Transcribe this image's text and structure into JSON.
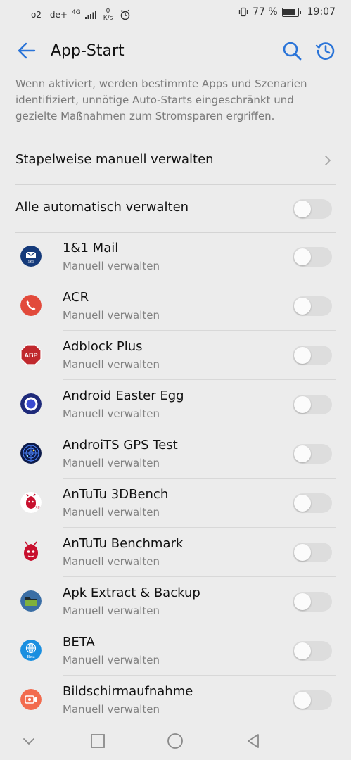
{
  "status": {
    "carrier": "o2 - de+",
    "network": "4G",
    "speed_value": "0",
    "speed_unit": "K/s",
    "battery": "77 %",
    "time": "19:07"
  },
  "header": {
    "title": "App-Start",
    "back_icon": "arrow-left-icon",
    "search_icon": "search-icon",
    "history_icon": "history-icon",
    "accent": "#2a74d8"
  },
  "description": "Wenn aktiviert, werden bestimmte Apps und Szenarien identifiziert, unnötige Auto-Starts eingeschränkt und gezielte Maßnahmen zum Stromsparen ergriffen.",
  "batch": {
    "label": "Stapelweise manuell verwalten"
  },
  "all_auto": {
    "label": "Alle automatisch verwalten",
    "enabled": false
  },
  "apps": [
    {
      "name": "1&1 Mail",
      "status": "Manuell verwalten",
      "icon": "mail-icon",
      "color": "#153a7a",
      "enabled": false
    },
    {
      "name": "ACR",
      "status": "Manuell verwalten",
      "icon": "phone-icon",
      "color": "#e24a3b",
      "enabled": false
    },
    {
      "name": "Adblock Plus",
      "status": "Manuell verwalten",
      "icon": "abp-icon",
      "color": "#c0282d",
      "enabled": false
    },
    {
      "name": "Android Easter Egg",
      "status": "Manuell verwalten",
      "icon": "easter-egg-icon",
      "color": "#1e2a7a",
      "enabled": false
    },
    {
      "name": "AndroiTS GPS Test",
      "status": "Manuell verwalten",
      "icon": "radar-icon",
      "color": "#0d1b4a",
      "enabled": false
    },
    {
      "name": "AnTuTu 3DBench",
      "status": "Manuell verwalten",
      "icon": "antutu-3d-icon",
      "color": "#c8102e",
      "enabled": false
    },
    {
      "name": "AnTuTu Benchmark",
      "status": "Manuell verwalten",
      "icon": "antutu-icon",
      "color": "#c8102e",
      "enabled": false
    },
    {
      "name": "Apk Extract & Backup",
      "status": "Manuell verwalten",
      "icon": "folder-icon",
      "color": "#3a6ea5",
      "enabled": false
    },
    {
      "name": "BETA",
      "status": "Manuell verwalten",
      "icon": "globe-icon",
      "color": "#1a8fe0",
      "enabled": false
    },
    {
      "name": "Bildschirmaufnahme",
      "status": "Manuell verwalten",
      "icon": "screen-record-icon",
      "color": "#f26b4e",
      "enabled": false
    }
  ],
  "navbar": {
    "icons": [
      "hide-nav-icon",
      "recents-icon",
      "home-icon",
      "back-nav-icon"
    ]
  }
}
